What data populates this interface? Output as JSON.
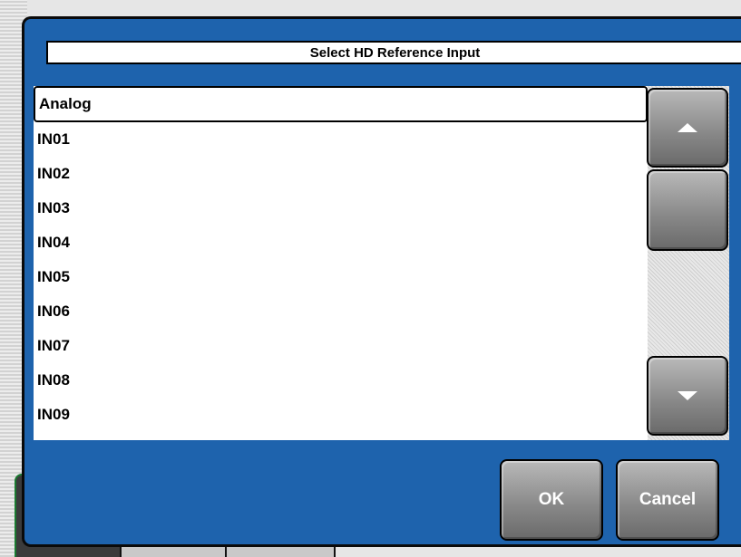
{
  "dialog": {
    "title": "Select HD Reference Input",
    "items": [
      "Analog",
      "IN01",
      "IN02",
      "IN03",
      "IN04",
      "IN05",
      "IN06",
      "IN07",
      "IN08",
      "IN09"
    ],
    "selected_index": 0,
    "ok_label": "OK",
    "cancel_label": "Cancel",
    "accent_color": "#1e63ad"
  },
  "icons": {
    "scroll_up": "arrow-up-icon",
    "scroll_down": "arrow-down-icon"
  }
}
